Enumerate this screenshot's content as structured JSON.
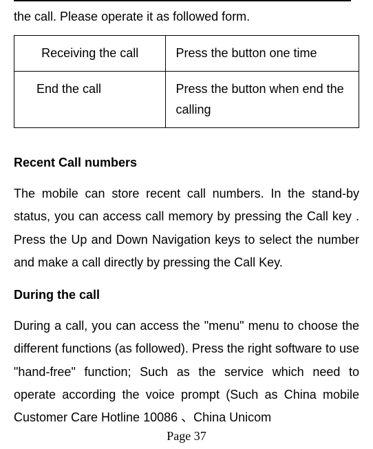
{
  "intro": "the call. Please operate it as followed form.",
  "table": {
    "rows": [
      {
        "left": "Receiving the call",
        "right": "Press the button one time"
      },
      {
        "left": "End the call",
        "right": "Press the button when end the calling"
      }
    ]
  },
  "sections": [
    {
      "heading": "Recent Call numbers",
      "body": "The mobile can store recent call numbers. In the stand-by status, you can access call memory by pressing the Call key . Press the Up and Down Navigation keys to select the number and make a call directly by pressing the Call Key."
    },
    {
      "heading": "During the call",
      "body": "During a call, you can access the \"menu\" menu to choose the different functions (as followed). Press the right software to use \"hand-free\" function; Such as the service which need to operate according the voice prompt (Such as China mobile Customer Care Hotline 10086 、China Unicom"
    }
  ],
  "pageNumber": "Page 37"
}
